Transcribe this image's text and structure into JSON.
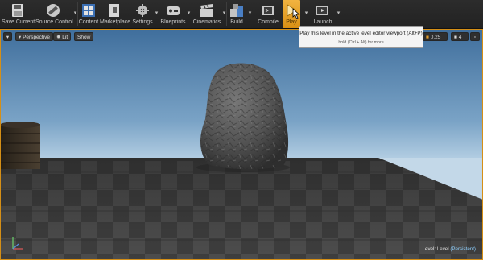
{
  "toolbar": {
    "items": [
      {
        "label": "Save Current",
        "icon": "save-icon"
      },
      {
        "label": "Source Control",
        "icon": "source-control-icon"
      },
      {
        "label": "Content",
        "icon": "content-browser-icon"
      },
      {
        "label": "Marketplace",
        "icon": "marketplace-icon"
      },
      {
        "label": "Settings",
        "icon": "settings-icon"
      },
      {
        "label": "Blueprints",
        "icon": "blueprints-icon"
      },
      {
        "label": "Cinematics",
        "icon": "cinematics-icon"
      },
      {
        "label": "Build",
        "icon": "build-icon"
      },
      {
        "label": "Compile",
        "icon": "compile-icon"
      },
      {
        "label": "Play",
        "icon": "play-icon"
      },
      {
        "label": "Launch",
        "icon": "launch-icon"
      }
    ],
    "active_color": "#e8a42a"
  },
  "viewport": {
    "perspective_label": "Perspective",
    "lit_label": "Lit",
    "show_label": "Show",
    "snap_value": "0.25",
    "camera_speed": "4",
    "level_prefix": "Level:",
    "level_name": "Level",
    "level_persistent": "(Persistent)",
    "border_color": "#d58f16"
  },
  "tooltip": {
    "title": "Play this level in the active level editor viewport (Alt+P)",
    "hint": "hold (Ctrl + Alt) for more"
  }
}
